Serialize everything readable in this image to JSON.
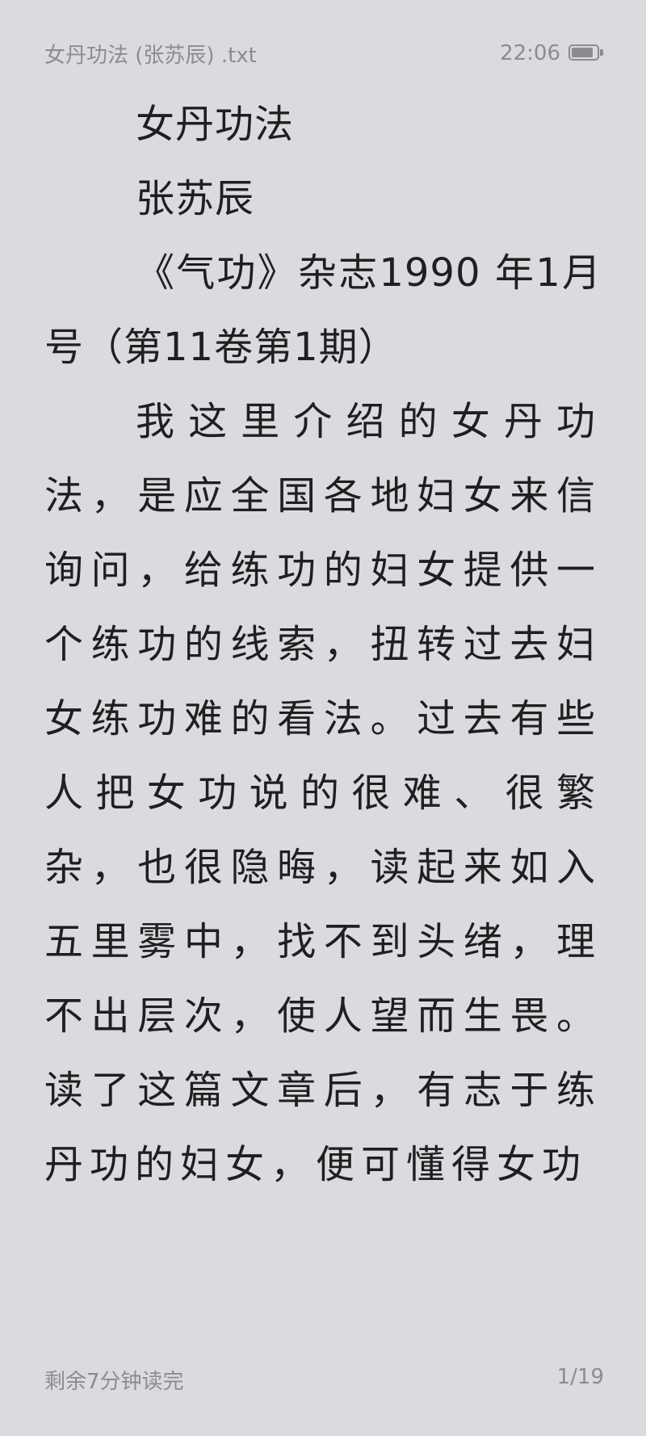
{
  "status_bar": {
    "file_title": "女丹功法 (张苏辰) .txt",
    "time": "22:06",
    "battery_level": 0.85
  },
  "content": {
    "paragraphs": [
      "女丹功法",
      "张苏辰",
      "《气功》杂志1990 年1月号（第11卷第1期）",
      "我这里介绍的女丹功法，是应全国各地妇女来信询问，给练功的妇女提供一个练功的线索，扭转过去妇女练功难的看法。过去有些人把女功说的很难、很繁杂，也很隐晦，读起来如入五里雾中，找不到头绪，理不出层次，使人望而生畏。读了这篇文章后，有志于练丹功的妇女，便可懂得女功"
    ]
  },
  "footer": {
    "reading_time": "剩余7分钟读完",
    "page_indicator": "1/19"
  }
}
